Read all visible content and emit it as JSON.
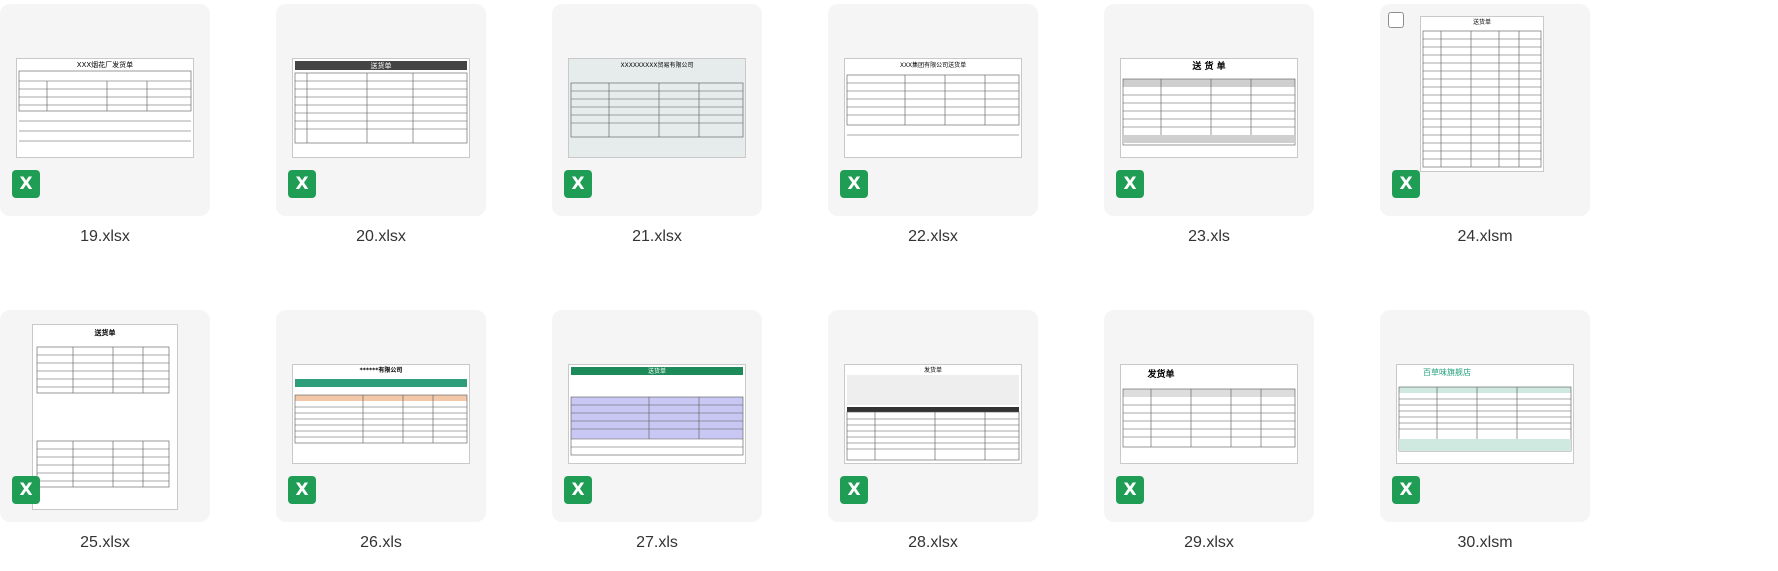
{
  "files": [
    {
      "name": "19.xlsx",
      "thumb_title": "XXX烟花厂发货单"
    },
    {
      "name": "20.xlsx",
      "thumb_title": "送货单"
    },
    {
      "name": "21.xlsx",
      "thumb_title": "XXXXXXXXX贸易有限公司"
    },
    {
      "name": "22.xlsx",
      "thumb_title": "XXX集团有限公司送货单"
    },
    {
      "name": "23.xls",
      "thumb_title": "送 货 单"
    },
    {
      "name": "24.xlsm",
      "thumb_title": "送货单"
    },
    {
      "name": "25.xlsx",
      "thumb_title": "送货单"
    },
    {
      "name": "26.xls",
      "thumb_title": "******有限公司"
    },
    {
      "name": "27.xls",
      "thumb_title": "送货单"
    },
    {
      "name": "28.xlsx",
      "thumb_title": "发货单"
    },
    {
      "name": "29.xlsx",
      "thumb_title": "发货单"
    },
    {
      "name": "30.xlsm",
      "thumb_title": "百草味旗舰店"
    }
  ],
  "icon_letter": "X",
  "colors": {
    "excel_green": "#1f9d55",
    "card_bg": "#f5f5f5"
  }
}
